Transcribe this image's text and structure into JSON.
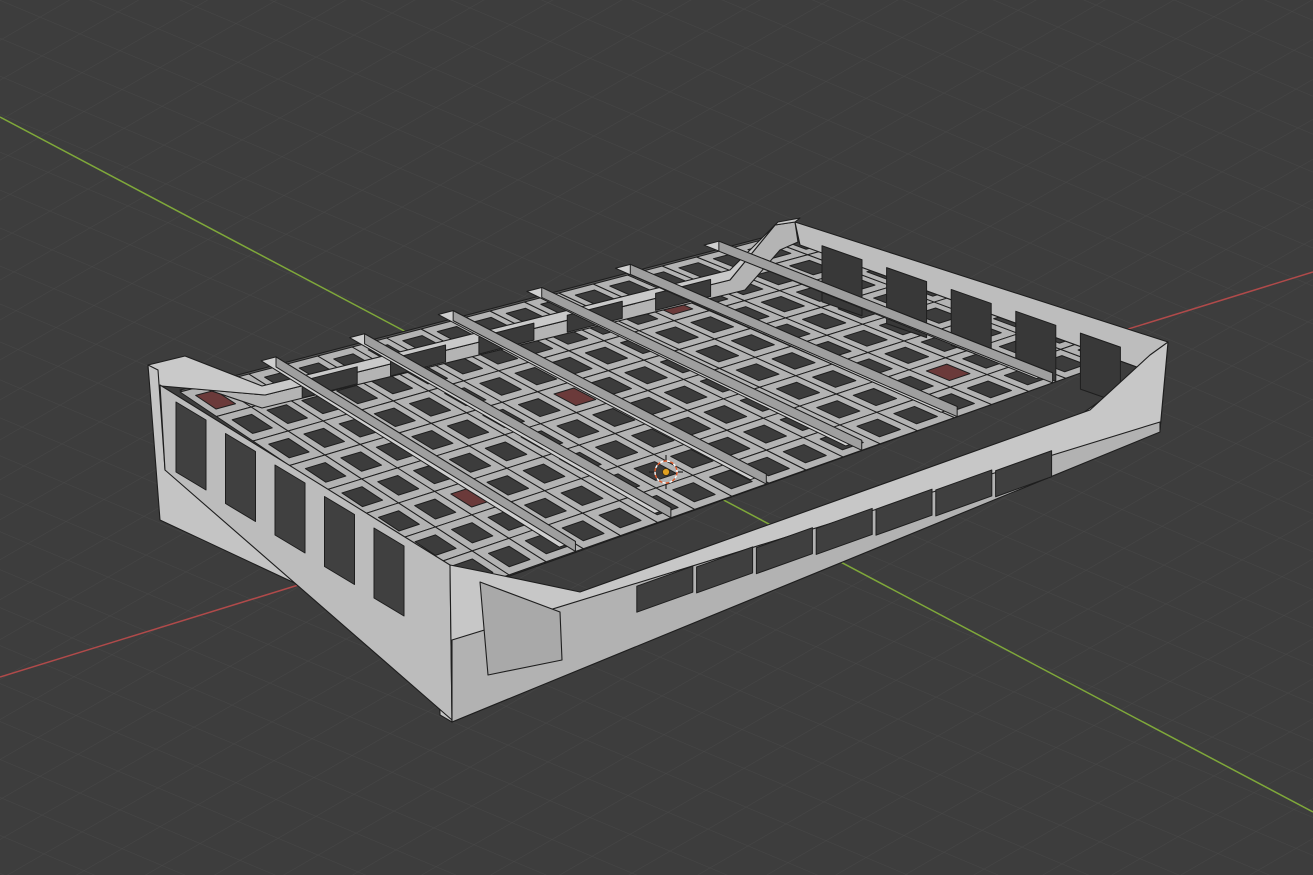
{
  "viewport": {
    "background": "#3d3d3d",
    "grid_line_color": "#4a4a4a",
    "x_axis_color": "#b04a4a",
    "y_axis_color": "#7fa83a"
  },
  "object": {
    "kind": "open basket tray mesh",
    "face_color": "#b9b9b9",
    "edge_color": "#1e1e1e",
    "interior_rails": 6,
    "side_slots": 5,
    "front_slots": 7
  },
  "cursor": {
    "icon": "3d-cursor-icon",
    "ring_color": "#e05a2a"
  }
}
